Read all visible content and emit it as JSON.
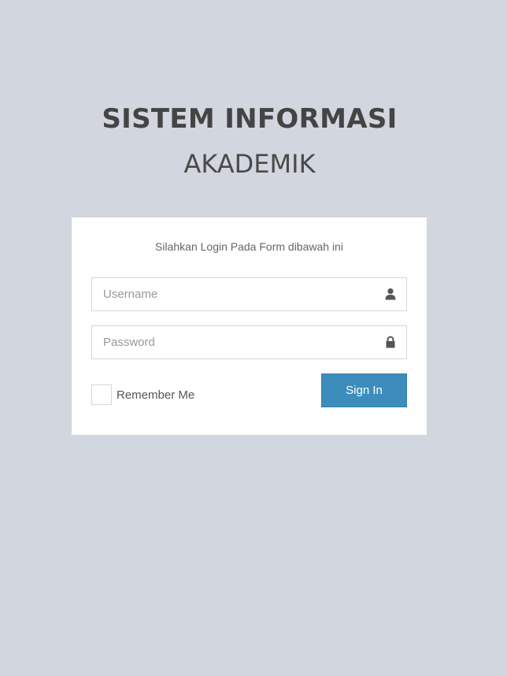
{
  "logo": {
    "main": "SISTEM INFORMASI",
    "sub": "AKADEMIK"
  },
  "login": {
    "message": "Silahkan Login Pada Form dibawah ini",
    "username": {
      "value": "",
      "placeholder": "Username",
      "icon": "user-icon"
    },
    "password": {
      "value": "",
      "placeholder": "Password",
      "icon": "lock-icon"
    },
    "remember_label": "Remember Me",
    "remember_checked": false,
    "submit_label": "Sign In"
  },
  "colors": {
    "background": "#d2d6de",
    "primary_button": "#3c8dbc",
    "icon": "#555555"
  }
}
